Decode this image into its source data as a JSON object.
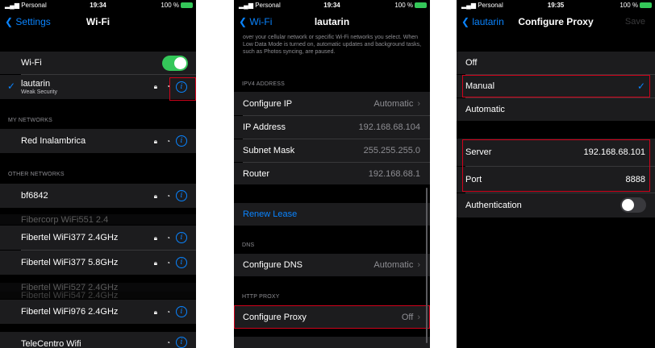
{
  "status_bar": {
    "carrier": "Personal",
    "times": [
      "19:34",
      "19:34",
      "19:35"
    ],
    "battery": "100 %"
  },
  "screen1": {
    "back": "Settings",
    "title": "Wi-Fi",
    "wifi_label": "Wi-Fi",
    "wifi_on": true,
    "connected_name": "lautarin",
    "connected_sub": "Weak Security",
    "my_networks_header": "MY NETWORKS",
    "my_networks": [
      "Red Inalambrica"
    ],
    "other_header": "OTHER NETWORKS",
    "other_networks": [
      "bf6842",
      "Fibercorp WiFi551 2.4",
      "Fibertel WiFi377 2.4GHz",
      "Fibertel WiFi377 5.8GHz",
      "Fibertel WiFi527 2.4GHz",
      "Fibertel WiFi547 2.4GHz",
      "Fibertel WiFi976 2.4GHz",
      "TeleCentro Wifi"
    ]
  },
  "screen2": {
    "back": "Wi-Fi",
    "title": "lautarin",
    "note": "over your cellular network or specific Wi-Fi networks you select. When Low Data Mode is turned on, automatic updates and background tasks, such as Photos syncing, are paused.",
    "ipv4_header": "IPV4 ADDRESS",
    "ipv4_rows": [
      {
        "label": "Configure IP",
        "value": "Automatic"
      },
      {
        "label": "IP Address",
        "value": "192.168.68.104"
      },
      {
        "label": "Subnet Mask",
        "value": "255.255.255.0"
      },
      {
        "label": "Router",
        "value": "192.168.68.1"
      }
    ],
    "renew": "Renew Lease",
    "dns_header": "DNS",
    "dns_label": "Configure DNS",
    "dns_value": "Automatic",
    "proxy_header": "HTTP PROXY",
    "proxy_label": "Configure Proxy",
    "proxy_value": "Off"
  },
  "screen3": {
    "back": "lautarin",
    "title": "Configure Proxy",
    "save": "Save",
    "options": [
      "Off",
      "Manual",
      "Automatic"
    ],
    "selected": "Manual",
    "server_label": "Server",
    "server_value": "192.168.68.101",
    "port_label": "Port",
    "port_value": "8888",
    "auth_label": "Authentication",
    "auth_on": false
  },
  "colors": {
    "accent": "#0a84ff",
    "toggle_on": "#34c759",
    "highlight": "#d0021b"
  },
  "icons": [
    "chevron-left-icon",
    "lock-icon",
    "wifi-icon",
    "info-icon",
    "checkmark-icon",
    "chevron-right-icon",
    "signal-icon",
    "battery-icon"
  ]
}
